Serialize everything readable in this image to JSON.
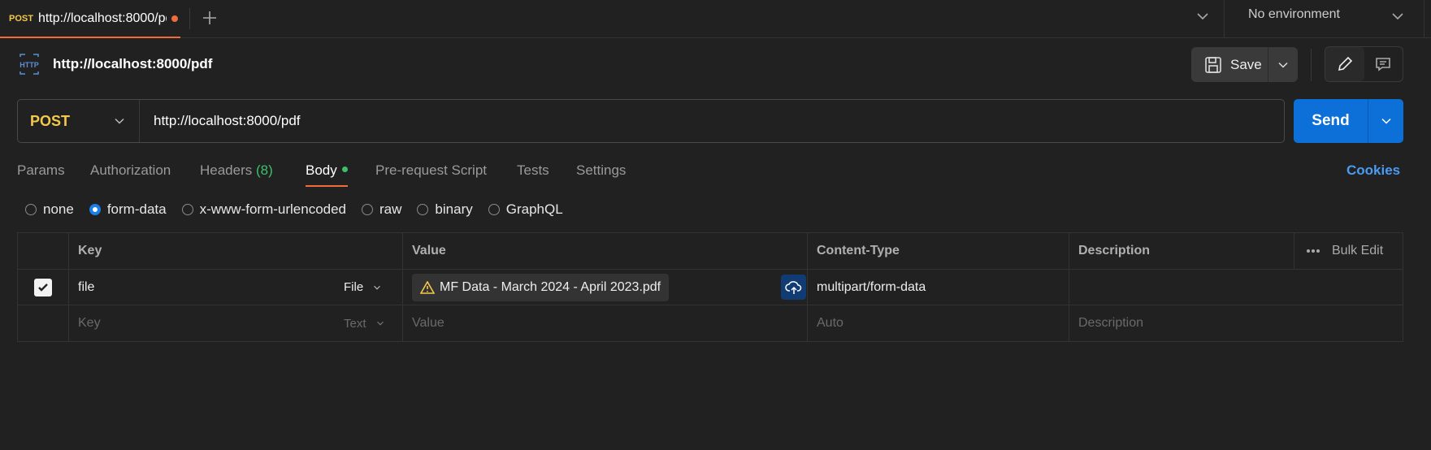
{
  "tabbar": {
    "tab": {
      "method": "POST",
      "title": "http://localhost:8000/pdf"
    },
    "environment": "No environment"
  },
  "request": {
    "title": "http://localhost:8000/pdf",
    "save_label": "Save",
    "method": "POST",
    "url": "http://localhost:8000/pdf",
    "send_label": "Send"
  },
  "req_tabs": {
    "params": "Params",
    "authorization": "Authorization",
    "headers": "Headers",
    "headers_count": "(8)",
    "body": "Body",
    "pre_request": "Pre-request Script",
    "tests": "Tests",
    "settings": "Settings",
    "cookies": "Cookies"
  },
  "body_types": {
    "none": "none",
    "form_data": "form-data",
    "urlencoded": "x-www-form-urlencoded",
    "raw": "raw",
    "binary": "binary",
    "graphql": "GraphQL",
    "selected": "form-data"
  },
  "table": {
    "headers": {
      "key": "Key",
      "value": "Value",
      "content_type": "Content-Type",
      "description": "Description",
      "bulk_edit": "Bulk Edit"
    },
    "row1": {
      "key": "file",
      "type": "File",
      "value": "MF Data - March 2024 - April 2023.pdf",
      "content_type": "multipart/form-data",
      "description": "",
      "checked": true
    },
    "new_row": {
      "key_ph": "Key",
      "type": "Text",
      "value_ph": "Value",
      "content_type_ph": "Auto",
      "description_ph": "Description"
    }
  },
  "colors": {
    "accent": "#f26b3a",
    "send": "#0d6fd8",
    "method": "#f3c94b",
    "link": "#4a9cf3",
    "body_dot": "#3fbf6a"
  }
}
